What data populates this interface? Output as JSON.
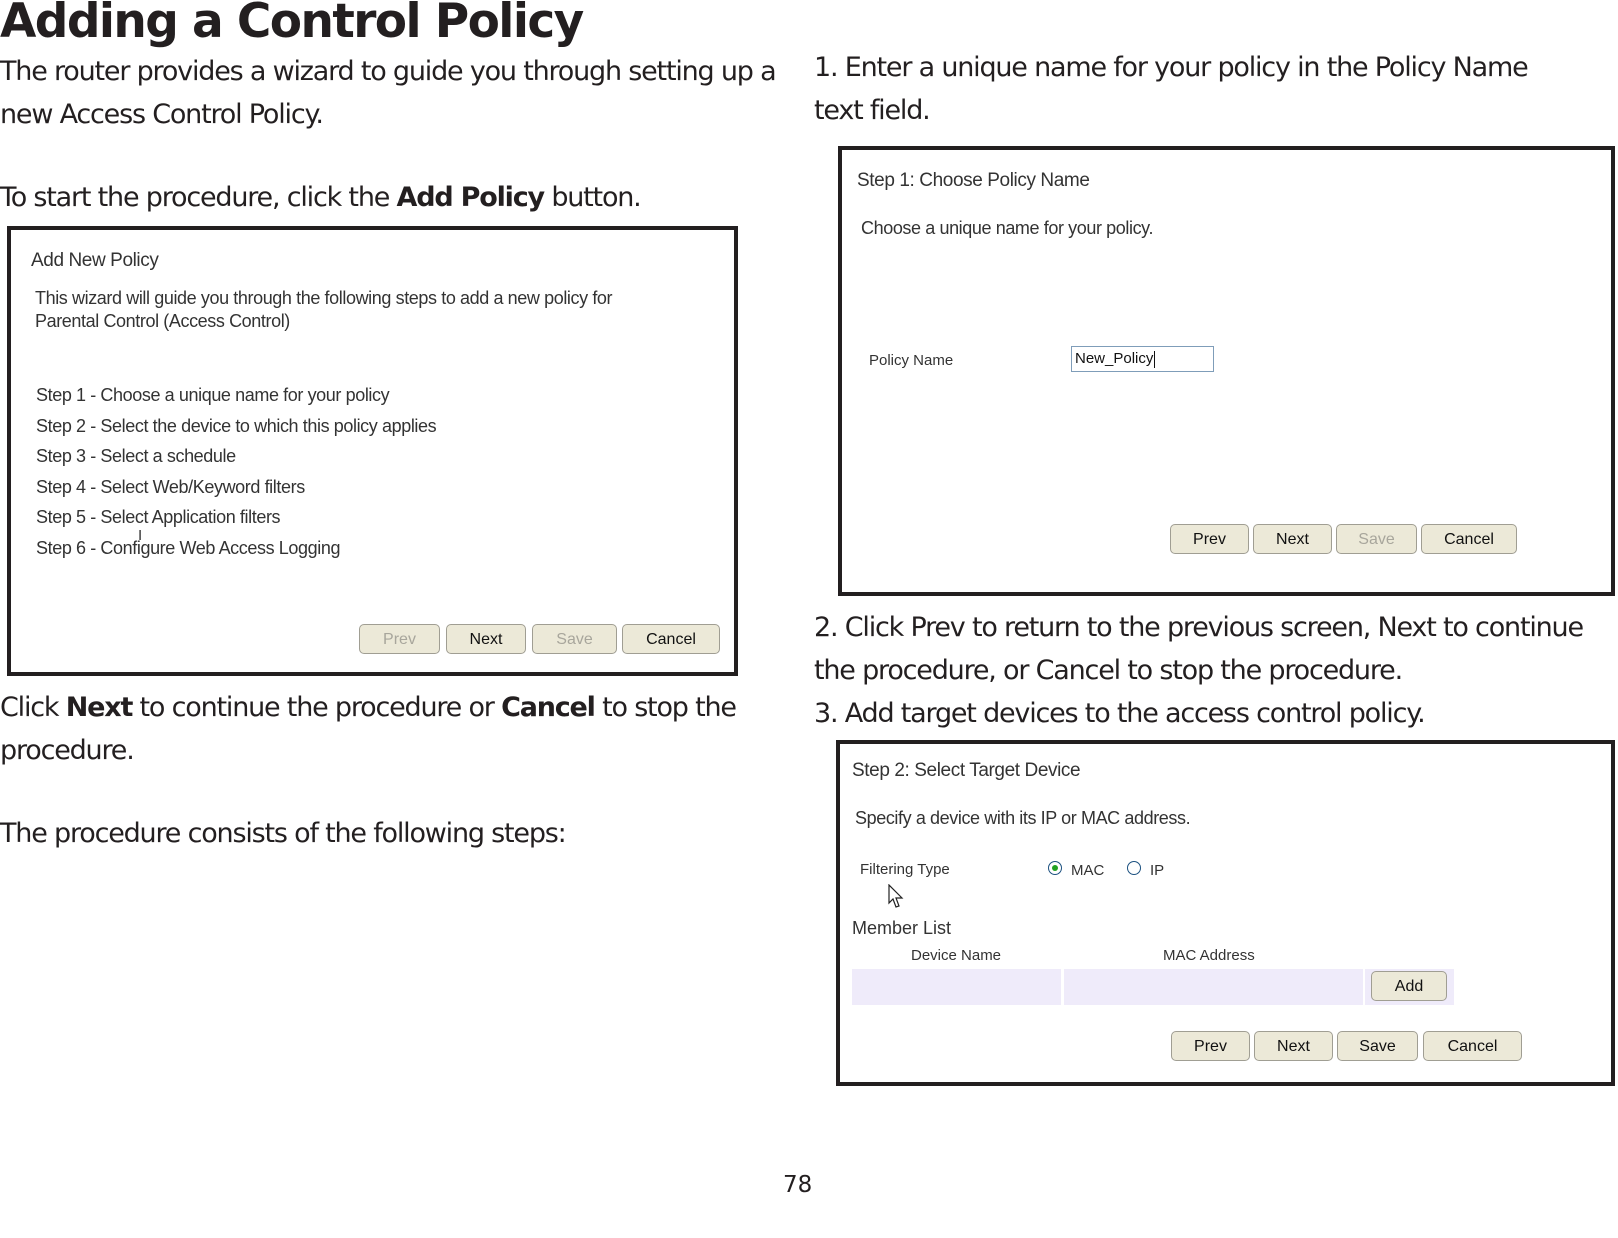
{
  "page": {
    "title": "Adding a Control Policy",
    "page_number": "78"
  },
  "left_column": {
    "intro_line1": "The router provides a wizard to guide you through setting up a",
    "intro_line2": "new Access Control Policy.",
    "start_prefix": "To start the procedure, click the ",
    "start_bold": "Add Policy",
    "start_suffix": " button.",
    "after_prefix": "Click ",
    "after_bold1": "Next",
    "after_mid": " to continue the procedure or ",
    "after_bold2": "Cancel",
    "after_suffix": " to stop the",
    "after_line2": "procedure.",
    "steps_intro": "The procedure consists of the following steps:"
  },
  "screen_add_policy": {
    "title": "Add New Policy",
    "description_line1": "This wizard will guide you through the following steps to add a new policy for",
    "description_line2": "Parental Control (Access Control)",
    "steps": [
      "Step 1 - Choose a unique name for your policy",
      "Step 2 - Select the device to which this policy applies",
      "Step 3 - Select a schedule",
      "Step 4 - Select Web/Keyword filters",
      "Step 5 - Select Application filters",
      "Step 6 - Configure Web Access Logging"
    ],
    "buttons": {
      "prev": "Prev",
      "next": "Next",
      "save": "Save",
      "cancel": "Cancel"
    },
    "button_states": {
      "prev": "disabled",
      "next": "enabled",
      "save": "disabled",
      "cancel": "enabled"
    }
  },
  "right_column": {
    "step1_line1": "1. Enter a unique name for your policy in the Policy Name",
    "step1_line2": "text field.",
    "step2_line1": "2. Click Prev to return to the previous screen, Next to continue",
    "step2_line2": "the procedure, or Cancel to stop the procedure.",
    "step3_line1": "3. Add target devices to the access control policy."
  },
  "screen_step1": {
    "title": "Step 1: Choose Policy Name",
    "description": "Choose a unique name for your policy.",
    "policy_name_label": "Policy Name",
    "policy_name_value": "New_Policy",
    "buttons": {
      "prev": "Prev",
      "next": "Next",
      "save": "Save",
      "cancel": "Cancel"
    },
    "button_states": {
      "prev": "enabled",
      "next": "enabled",
      "save": "disabled",
      "cancel": "enabled"
    }
  },
  "screen_step2": {
    "title": "Step 2: Select Target Device",
    "description": "Specify a device with its IP or MAC address.",
    "filtering_type_label": "Filtering Type",
    "filtering_options": [
      {
        "label": "MAC",
        "checked": true
      },
      {
        "label": "IP",
        "checked": false
      }
    ],
    "member_list_label": "Member List",
    "table_headers": [
      "Device Name",
      "MAC Address"
    ],
    "add_button": "Add",
    "buttons": {
      "prev": "Prev",
      "next": "Next",
      "save": "Save",
      "cancel": "Cancel"
    },
    "button_states": {
      "prev": "enabled",
      "next": "enabled",
      "save": "enabled",
      "cancel": "enabled"
    }
  }
}
